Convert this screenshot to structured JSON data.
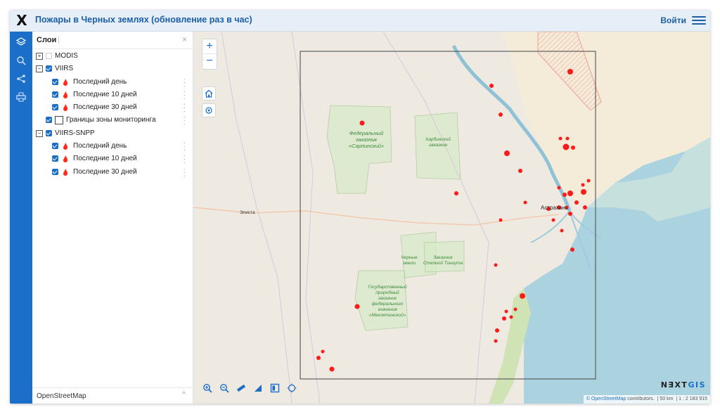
{
  "header": {
    "logo_text": "X",
    "title": "Пожары в Черных землях (обновление раз в час)",
    "login_label": "Войти",
    "menu_icon": "hamburger-icon"
  },
  "sidebar_icons": [
    "layers-icon",
    "search-icon",
    "share-icon",
    "print-icon"
  ],
  "layers_panel": {
    "title": "Слои",
    "close_label": "×",
    "items": [
      {
        "label": "MODIS",
        "checked": false,
        "expanded": false
      },
      {
        "label": "VIIRS",
        "checked": true,
        "expanded": true
      },
      {
        "label": "Последний день",
        "checked": true,
        "icon": "fire-icon"
      },
      {
        "label": "Последние 10 дней",
        "checked": true,
        "icon": "fire-icon"
      },
      {
        "label": "Последние 30 дней",
        "checked": true,
        "icon": "fire-icon"
      },
      {
        "label": "Границы зоны мониторинга",
        "checked": true,
        "icon": "polygon-icon"
      },
      {
        "label": "VIIRS-SNPP",
        "checked": true,
        "expanded": true
      },
      {
        "label": "Последний день",
        "checked": true,
        "icon": "fire-icon"
      },
      {
        "label": "Последние 10 дней",
        "checked": true,
        "icon": "fire-icon"
      },
      {
        "label": "Последние 30 дней",
        "checked": true,
        "icon": "fire-icon"
      }
    ],
    "basemap_label": "OpenStreetMap",
    "basemap_caret": "^"
  },
  "map": {
    "zoom_in": "+",
    "zoom_out": "−",
    "labels": {
      "sarpa": [
        "Федеральный",
        "заказник",
        "«Сарпинский»"
      ],
      "harbin": [
        "Харбинский",
        "заказник"
      ],
      "elista": "Элиста",
      "astrakhan": "Астрахань",
      "chernye": [
        "Черные",
        "земли"
      ],
      "stepnoy": [
        "Заказник",
        "Степной Тингута"
      ],
      "mekletin": [
        "Государственный",
        "природный",
        "заказник",
        "федерального",
        "значения",
        "«Меклетинский»"
      ]
    },
    "brand": {
      "prefix": "N∃XT",
      "suffix": "GIS"
    },
    "attribution": {
      "osm": "© OpenStreetMap",
      "rest": "contributors.",
      "scale_km": "50 km",
      "scale_ratio": "1 : 2 183 915"
    },
    "tool_icons": [
      "zoom-in-box-icon",
      "zoom-out-box-icon",
      "measure-distance-icon",
      "measure-area-icon",
      "identify-icon",
      "locate-icon"
    ],
    "colors": {
      "fire": "#ff1a1a",
      "water": "#aad3df",
      "land": "#eeeae2",
      "accent": "#1c6fc8"
    }
  }
}
